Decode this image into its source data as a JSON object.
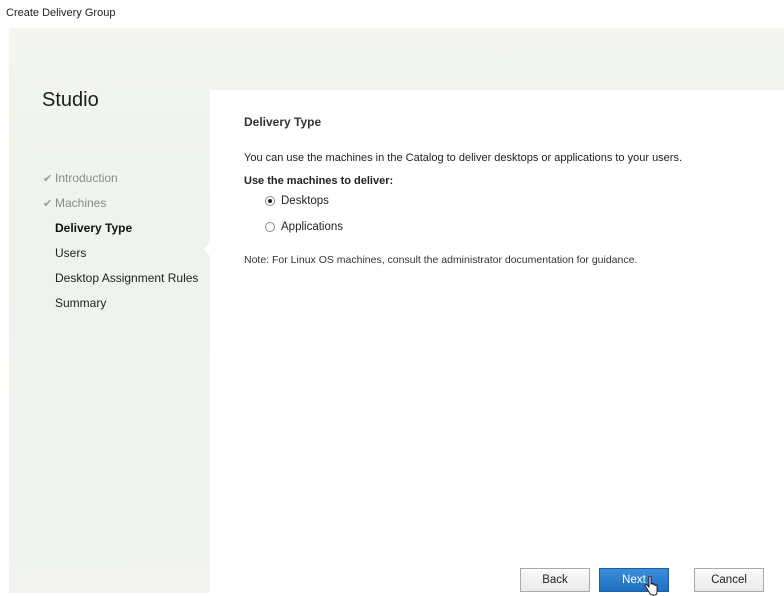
{
  "window": {
    "title": "Create Delivery Group"
  },
  "sidebar": {
    "title": "Studio",
    "steps": [
      {
        "label": "Introduction",
        "state": "done"
      },
      {
        "label": "Machines",
        "state": "done"
      },
      {
        "label": "Delivery Type",
        "state": "active"
      },
      {
        "label": "Users",
        "state": "pending"
      },
      {
        "label": "Desktop Assignment Rules",
        "state": "pending"
      },
      {
        "label": "Summary",
        "state": "pending"
      }
    ]
  },
  "main": {
    "section_title": "Delivery Type",
    "description": "You can use the machines in the Catalog to deliver desktops or applications to your users.",
    "use_label": "Use the machines to deliver:",
    "options": [
      {
        "label": "Desktops",
        "selected": true
      },
      {
        "label": "Applications",
        "selected": false
      }
    ],
    "note": "Note: For Linux OS machines, consult the administrator documentation for guidance."
  },
  "buttons": {
    "back": "Back",
    "next": "Next",
    "cancel": "Cancel"
  },
  "colors": {
    "primary_button": "#2a7fcf",
    "dialog_background": "#eef3ec"
  },
  "icons": {
    "step_done": "check-icon",
    "cursor": "hand-pointer-icon"
  }
}
